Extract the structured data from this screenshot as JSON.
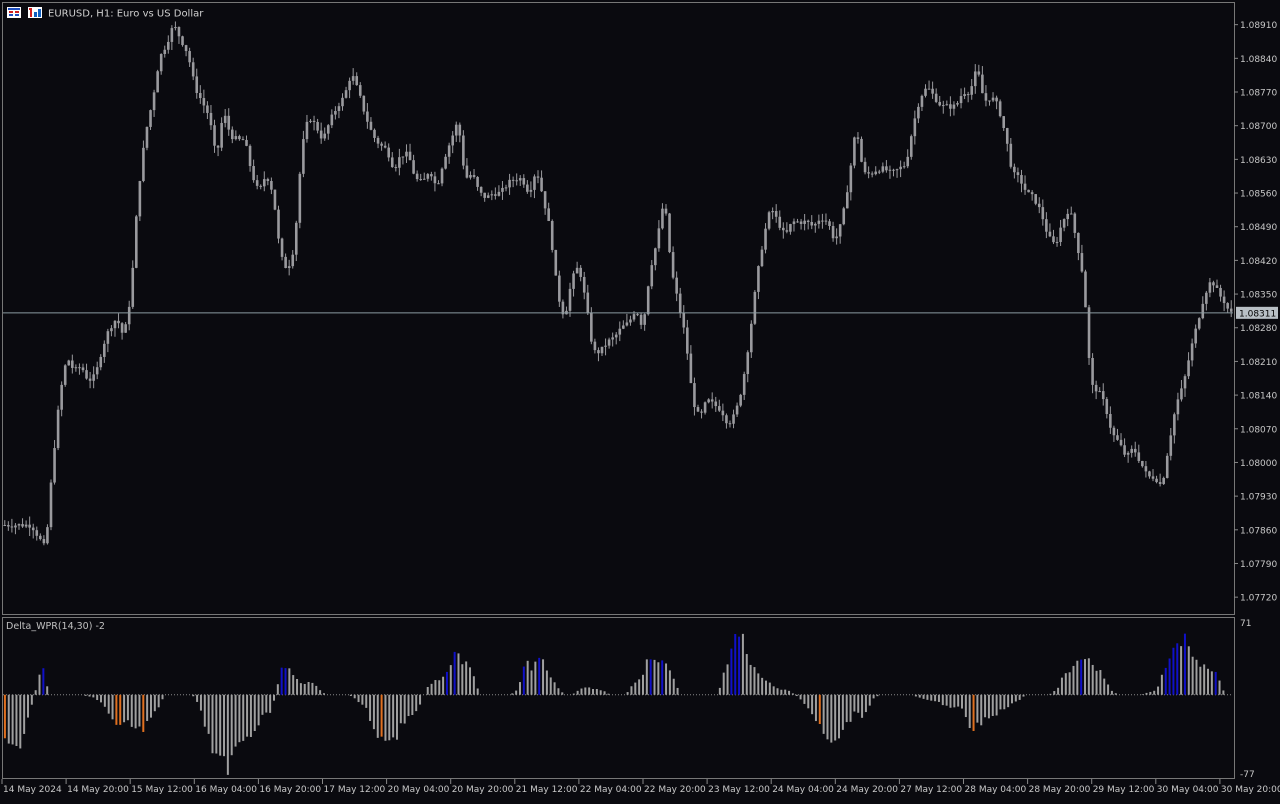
{
  "header": {
    "title": "EURUSD, H1:  Euro vs US Dollar",
    "icons": [
      "symbol-grid-icon",
      "chart-type-icon"
    ]
  },
  "colors": {
    "background": "#0a0a0f",
    "candle": "#9a9a9e",
    "price_line": "#8a9aa0",
    "price_label_bg": "#b9c0c6",
    "axis_text": "#c8c8c8",
    "hist_neutral": "#a0a0a0",
    "hist_up": "#1010c8",
    "hist_down": "#e07020"
  },
  "chart_data": [
    {
      "type": "candlestick",
      "symbol": "EURUSD",
      "timeframe": "H1",
      "title": "EURUSD, H1:  Euro vs US Dollar",
      "ylim": [
        1.07685,
        1.08955
      ],
      "y_ticks": [
        "1.08910",
        "1.08840",
        "1.08770",
        "1.08700",
        "1.08630",
        "1.08560",
        "1.08490",
        "1.08420",
        "1.08350",
        "1.08280",
        "1.08210",
        "1.08140",
        "1.08070",
        "1.08000",
        "1.07930",
        "1.07860",
        "1.07790",
        "1.07720"
      ],
      "current_price": "1.08311",
      "x_ticks": [
        "14 May 2024",
        "14 May 20:00",
        "15 May 12:00",
        "16 May 04:00",
        "16 May 20:00",
        "17 May 12:00",
        "20 May 04:00",
        "20 May 20:00",
        "21 May 12:00",
        "22 May 04:00",
        "22 May 20:00",
        "23 May 12:00",
        "24 May 04:00",
        "24 May 20:00",
        "27 May 12:00",
        "28 May 04:00",
        "28 May 20:00",
        "29 May 12:00",
        "30 May 04:00",
        "30 May 20:00"
      ],
      "close_path": [
        [
          0,
          1.0787
        ],
        [
          8,
          1.0787
        ],
        [
          12,
          1.0782
        ],
        [
          14,
          1.08
        ],
        [
          16,
          1.0814
        ],
        [
          18,
          1.0822
        ],
        [
          20,
          1.0819
        ],
        [
          22,
          1.082
        ],
        [
          24,
          1.0817
        ],
        [
          26,
          1.0818
        ],
        [
          28,
          1.0824
        ],
        [
          30,
          1.0828
        ],
        [
          32,
          1.083
        ],
        [
          34,
          1.0826
        ],
        [
          36,
          1.0835
        ],
        [
          38,
          1.0856
        ],
        [
          40,
          1.0868
        ],
        [
          42,
          1.0875
        ],
        [
          44,
          1.0884
        ],
        [
          46,
          1.0887
        ],
        [
          48,
          1.0891
        ],
        [
          50,
          1.0888
        ],
        [
          52,
          1.0885
        ],
        [
          54,
          1.0878
        ],
        [
          56,
          1.0875
        ],
        [
          58,
          1.0872
        ],
        [
          60,
          1.0863
        ],
        [
          62,
          1.0873
        ],
        [
          64,
          1.0868
        ],
        [
          66,
          1.0867
        ],
        [
          68,
          1.0867
        ],
        [
          70,
          1.086
        ],
        [
          72,
          1.0856
        ],
        [
          74,
          1.086
        ],
        [
          76,
          1.0856
        ],
        [
          78,
          1.0843
        ],
        [
          80,
          1.084
        ],
        [
          82,
          1.0845
        ],
        [
          84,
          1.0865
        ],
        [
          86,
          1.0872
        ],
        [
          88,
          1.087
        ],
        [
          90,
          1.0867
        ],
        [
          92,
          1.0871
        ],
        [
          94,
          1.0874
        ],
        [
          96,
          1.0876
        ],
        [
          98,
          1.0881
        ],
        [
          100,
          1.0877
        ],
        [
          102,
          1.0872
        ],
        [
          104,
          1.0868
        ],
        [
          106,
          1.0866
        ],
        [
          108,
          1.0865
        ],
        [
          110,
          1.0861
        ],
        [
          112,
          1.0864
        ],
        [
          114,
          1.0864
        ],
        [
          116,
          1.0859
        ],
        [
          118,
          1.0858
        ],
        [
          120,
          1.0861
        ],
        [
          122,
          1.0857
        ],
        [
          124,
          1.0863
        ],
        [
          126,
          1.0867
        ],
        [
          128,
          1.0871
        ],
        [
          130,
          1.0859
        ],
        [
          132,
          1.086
        ],
        [
          134,
          1.0856
        ],
        [
          136,
          1.0855
        ],
        [
          138,
          1.0856
        ],
        [
          140,
          1.0856
        ],
        [
          142,
          1.0858
        ],
        [
          144,
          1.0859
        ],
        [
          146,
          1.0859
        ],
        [
          148,
          1.0856
        ],
        [
          150,
          1.0861
        ],
        [
          152,
          1.0855
        ],
        [
          154,
          1.0848
        ],
        [
          156,
          1.0835
        ],
        [
          158,
          1.083
        ],
        [
          160,
          1.0838
        ],
        [
          162,
          1.0841
        ],
        [
          164,
          1.0833
        ],
        [
          166,
          1.0823
        ],
        [
          168,
          1.0823
        ],
        [
          170,
          1.0825
        ],
        [
          172,
          1.0826
        ],
        [
          174,
          1.0828
        ],
        [
          176,
          1.0829
        ],
        [
          178,
          1.0832
        ],
        [
          180,
          1.0828
        ],
        [
          182,
          1.084
        ],
        [
          184,
          1.0846
        ],
        [
          186,
          1.0855
        ],
        [
          188,
          1.084
        ],
        [
          190,
          1.0833
        ],
        [
          192,
          1.0826
        ],
        [
          194,
          1.0813
        ],
        [
          196,
          1.0809
        ],
        [
          198,
          1.0813
        ],
        [
          200,
          1.0812
        ],
        [
          202,
          1.0811
        ],
        [
          204,
          1.0808
        ],
        [
          206,
          1.081
        ],
        [
          208,
          1.0816
        ],
        [
          210,
          1.0826
        ],
        [
          212,
          1.0838
        ],
        [
          214,
          1.0847
        ],
        [
          216,
          1.0853
        ],
        [
          218,
          1.085
        ],
        [
          220,
          1.0847
        ],
        [
          222,
          1.085
        ],
        [
          224,
          1.085
        ],
        [
          226,
          1.085
        ],
        [
          228,
          1.0849
        ],
        [
          230,
          1.0851
        ],
        [
          232,
          1.085
        ],
        [
          234,
          1.0846
        ],
        [
          236,
          1.085
        ],
        [
          238,
          1.0859
        ],
        [
          240,
          1.087
        ],
        [
          242,
          1.086
        ],
        [
          244,
          1.086
        ],
        [
          246,
          1.0861
        ],
        [
          248,
          1.0861
        ],
        [
          250,
          1.086
        ],
        [
          252,
          1.0861
        ],
        [
          254,
          1.0862
        ],
        [
          256,
          1.087
        ],
        [
          258,
          1.0876
        ],
        [
          260,
          1.0878
        ],
        [
          262,
          1.0876
        ],
        [
          264,
          1.0874
        ],
        [
          266,
          1.0874
        ],
        [
          268,
          1.0874
        ],
        [
          270,
          1.0877
        ],
        [
          272,
          1.0877
        ],
        [
          274,
          1.0882
        ],
        [
          276,
          1.0875
        ],
        [
          278,
          1.0876
        ],
        [
          280,
          1.0874
        ],
        [
          282,
          1.0868
        ],
        [
          284,
          1.086
        ],
        [
          286,
          1.0859
        ],
        [
          288,
          1.0856
        ],
        [
          290,
          1.0855
        ],
        [
          292,
          1.0852
        ],
        [
          294,
          1.0847
        ],
        [
          296,
          1.0845
        ],
        [
          298,
          1.085
        ],
        [
          300,
          1.0853
        ],
        [
          302,
          1.0846
        ],
        [
          304,
          1.0838
        ],
        [
          306,
          1.0816
        ],
        [
          308,
          1.0815
        ],
        [
          310,
          1.0812
        ],
        [
          312,
          1.0806
        ],
        [
          314,
          1.0804
        ],
        [
          316,
          1.0801
        ],
        [
          318,
          1.0803
        ],
        [
          320,
          1.08
        ],
        [
          322,
          1.0797
        ],
        [
          324,
          1.0797
        ],
        [
          326,
          1.0795
        ],
        [
          328,
          1.0804
        ],
        [
          330,
          1.0812
        ],
        [
          332,
          1.0816
        ],
        [
          334,
          1.0823
        ],
        [
          336,
          1.0829
        ],
        [
          338,
          1.0835
        ],
        [
          340,
          1.0838
        ],
        [
          342,
          1.0835
        ],
        [
          344,
          1.0833
        ],
        [
          345,
          1.0831
        ]
      ]
    },
    {
      "type": "bar",
      "title": "Delta_WPR(14,30) -2",
      "ylim": [
        -77,
        71
      ],
      "y_ticks": [
        "71",
        "-77"
      ],
      "colors_legend": {
        "neutral": "#a0a0a0",
        "up": "#1010c8",
        "down": "#e07020"
      },
      "value_path": [
        [
          0,
          -40
        ],
        [
          5,
          -45
        ],
        [
          7,
          -12
        ],
        [
          8,
          -5
        ],
        [
          10,
          30
        ],
        [
          12,
          0
        ],
        [
          20,
          0
        ],
        [
          24,
          -3
        ],
        [
          26,
          -8
        ],
        [
          30,
          -30
        ],
        [
          32,
          -20
        ],
        [
          34,
          -28
        ],
        [
          36,
          -35
        ],
        [
          40,
          -15
        ],
        [
          42,
          0
        ],
        [
          48,
          0
        ],
        [
          50,
          -2
        ],
        [
          52,
          -20
        ],
        [
          54,
          -45
        ],
        [
          56,
          -60
        ],
        [
          58,
          -68
        ],
        [
          60,
          -55
        ],
        [
          62,
          -45
        ],
        [
          64,
          -40
        ],
        [
          66,
          -30
        ],
        [
          68,
          -18
        ],
        [
          70,
          -15
        ],
        [
          72,
          20
        ],
        [
          74,
          30
        ],
        [
          76,
          18
        ],
        [
          78,
          10
        ],
        [
          80,
          14
        ],
        [
          82,
          5
        ],
        [
          84,
          0
        ],
        [
          90,
          0
        ],
        [
          94,
          -10
        ],
        [
          96,
          -25
        ],
        [
          98,
          -40
        ],
        [
          100,
          -52
        ],
        [
          102,
          -40
        ],
        [
          104,
          -28
        ],
        [
          106,
          -20
        ],
        [
          108,
          -15
        ],
        [
          110,
          5
        ],
        [
          112,
          12
        ],
        [
          114,
          15
        ],
        [
          116,
          25
        ],
        [
          118,
          42
        ],
        [
          120,
          30
        ],
        [
          122,
          22
        ],
        [
          124,
          0
        ],
        [
          126,
          0
        ],
        [
          128,
          0
        ],
        [
          132,
          0
        ],
        [
          134,
          6
        ],
        [
          136,
          30
        ],
        [
          138,
          25
        ],
        [
          140,
          32
        ],
        [
          142,
          20
        ],
        [
          144,
          8
        ],
        [
          146,
          0
        ],
        [
          148,
          0
        ],
        [
          150,
          5
        ],
        [
          152,
          8
        ],
        [
          154,
          5
        ],
        [
          156,
          4
        ],
        [
          158,
          0
        ],
        [
          162,
          0
        ],
        [
          164,
          10
        ],
        [
          166,
          15
        ],
        [
          168,
          35
        ],
        [
          170,
          32
        ],
        [
          172,
          28
        ],
        [
          174,
          22
        ],
        [
          176,
          0
        ],
        [
          180,
          0
        ],
        [
          182,
          0
        ],
        [
          186,
          0
        ],
        [
          188,
          25
        ],
        [
          190,
          50
        ],
        [
          192,
          62
        ],
        [
          194,
          30
        ],
        [
          196,
          25
        ],
        [
          198,
          14
        ],
        [
          200,
          10
        ],
        [
          202,
          5
        ],
        [
          204,
          5
        ],
        [
          206,
          0
        ],
        [
          208,
          -5
        ],
        [
          210,
          -15
        ],
        [
          212,
          -25
        ],
        [
          214,
          -40
        ],
        [
          216,
          -48
        ],
        [
          218,
          -38
        ],
        [
          220,
          -25
        ],
        [
          222,
          -15
        ],
        [
          224,
          -20
        ],
        [
          226,
          -5
        ],
        [
          228,
          0
        ],
        [
          236,
          0
        ],
        [
          238,
          -2
        ],
        [
          240,
          -5
        ],
        [
          242,
          -6
        ],
        [
          244,
          -8
        ],
        [
          246,
          -10
        ],
        [
          248,
          -12
        ],
        [
          250,
          -15
        ],
        [
          252,
          -35
        ],
        [
          254,
          -28
        ],
        [
          256,
          -22
        ],
        [
          258,
          -18
        ],
        [
          260,
          -14
        ],
        [
          262,
          -10
        ],
        [
          264,
          -6
        ],
        [
          266,
          0
        ],
        [
          268,
          0
        ],
        [
          272,
          0
        ],
        [
          274,
          4
        ],
        [
          276,
          18
        ],
        [
          278,
          25
        ],
        [
          280,
          32
        ],
        [
          282,
          36
        ],
        [
          284,
          28
        ],
        [
          286,
          20
        ],
        [
          288,
          5
        ],
        [
          290,
          0
        ],
        [
          296,
          0
        ],
        [
          298,
          2
        ],
        [
          300,
          5
        ],
        [
          302,
          20
        ],
        [
          304,
          40
        ],
        [
          306,
          50
        ],
        [
          308,
          50
        ],
        [
          310,
          35
        ],
        [
          312,
          28
        ],
        [
          314,
          22
        ],
        [
          316,
          18
        ],
        [
          318,
          0
        ]
      ]
    }
  ]
}
